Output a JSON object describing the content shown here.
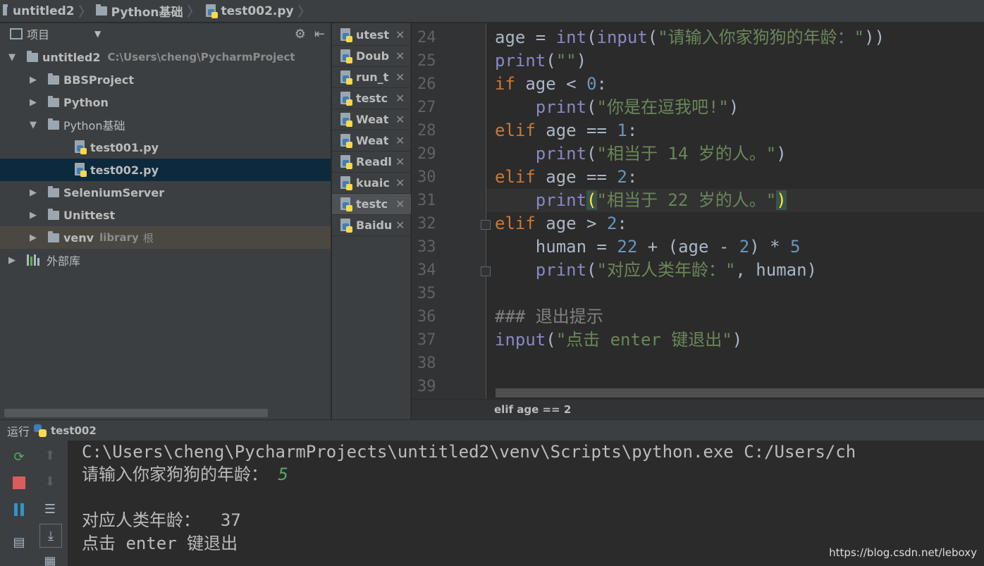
{
  "breadcrumb": {
    "items": [
      "untitled2",
      "Python基础",
      "test002.py"
    ]
  },
  "project": {
    "header_label": "项目",
    "root": {
      "name": "untitled2",
      "path": "C:\\Users\\cheng\\PycharmProject"
    },
    "folders": [
      "BBSProject",
      "Python",
      "Python基础"
    ],
    "files": [
      "test001.py",
      "test002.py"
    ],
    "more_folders": [
      "SeleniumServer",
      "Unittest"
    ],
    "venv": {
      "name": "venv",
      "tag": "library",
      "tag_suffix": "根"
    },
    "external_libs": "外部库"
  },
  "tabs": [
    "utest",
    "Doub",
    "run_t",
    "testc",
    "Weat",
    "Weat",
    "Readl",
    "kuaic",
    "testc",
    "Baidu"
  ],
  "editor": {
    "line_numbers": [
      "24",
      "25",
      "26",
      "27",
      "28",
      "29",
      "30",
      "31",
      "32",
      "33",
      "34",
      "35",
      "36",
      "37",
      "38",
      "39"
    ],
    "code": {
      "l24": {
        "var": "age",
        "eq": " = ",
        "f1": "int",
        "p1": "(",
        "f2": "input",
        "p2": "(",
        "str": "\"请输入你家狗狗的年龄：\"",
        "end": "))"
      },
      "l25": {
        "fn": "print",
        "open": "(",
        "str": "\"\"",
        "close": ")"
      },
      "l26": {
        "kw": "if",
        "rest": " age < ",
        "num": "0",
        "colon": ":"
      },
      "l27": {
        "indent": "    ",
        "fn": "print",
        "open": "(",
        "str": "\"你是在逗我吧!\"",
        "close": ")"
      },
      "l28": {
        "kw": "elif",
        "rest": " age == ",
        "num": "1",
        "colon": ":"
      },
      "l29": {
        "indent": "    ",
        "fn": "print",
        "open": "(",
        "str": "\"相当于 14 岁的人。\"",
        "close": ")"
      },
      "l30": {
        "kw": "elif",
        "rest": " age == ",
        "num": "2",
        "colon": ":"
      },
      "l31": {
        "indent": "    ",
        "fn": "print",
        "open": "(",
        "str": "\"相当于 22 岁的人。\"",
        "close": ")"
      },
      "l32": {
        "kw": "elif",
        "rest": " age > ",
        "num": "2",
        "colon": ":"
      },
      "l33": {
        "indent": "    ",
        "a": "human = ",
        "n1": "22",
        "b": " + (age - ",
        "n2": "2",
        "c": ") * ",
        "n3": "5"
      },
      "l34": {
        "indent": "    ",
        "fn": "print",
        "open": "(",
        "str": "\"对应人类年龄：\"",
        "mid": ", human)"
      },
      "l36": {
        "comment": "### 退出提示"
      },
      "l37": {
        "fn": "input",
        "open": "(",
        "str": "\"点击 enter 键退出\"",
        "close": ")"
      }
    },
    "context": "elif age == 2"
  },
  "run": {
    "label": "运行",
    "config": "test002",
    "console": {
      "cmd": "C:\\Users\\cheng\\PycharmProjects\\untitled2\\venv\\Scripts\\python.exe C:/Users/ch",
      "prompt": "请输入你家狗狗的年龄：",
      "input": "5",
      "result": "对应人类年龄：  37",
      "exit": "点击 enter 键退出"
    }
  },
  "watermark": "https://blog.csdn.net/leboxy"
}
